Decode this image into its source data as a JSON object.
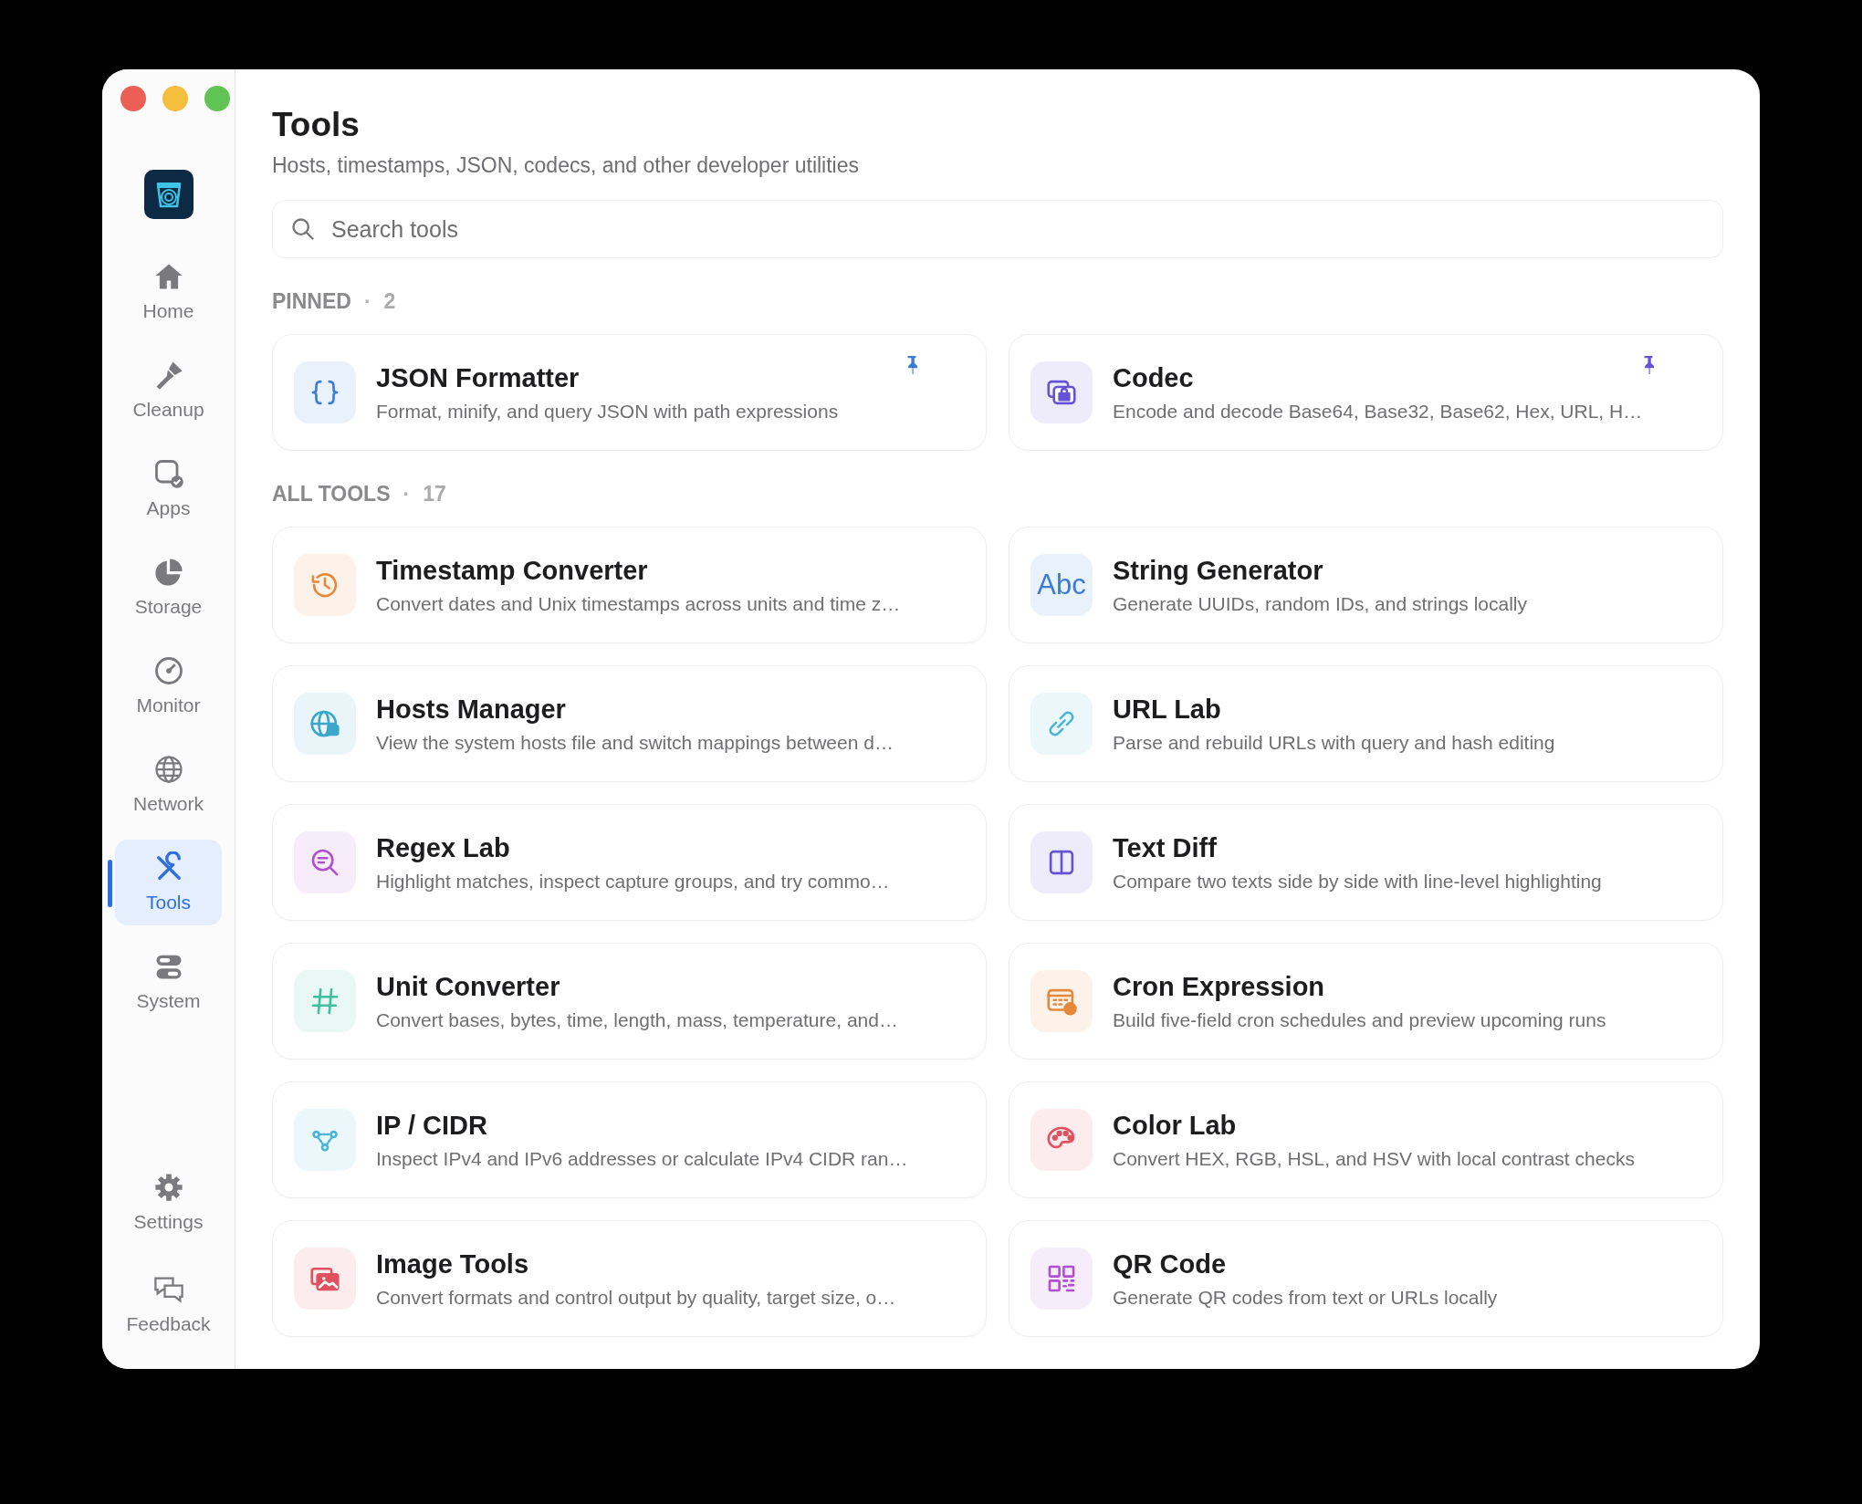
{
  "sidebar": {
    "items": [
      {
        "label": "Home",
        "kind": "home",
        "selected": false
      },
      {
        "label": "Cleanup",
        "kind": "brush",
        "selected": false
      },
      {
        "label": "Apps",
        "kind": "apps",
        "selected": false
      },
      {
        "label": "Storage",
        "kind": "pie",
        "selected": false
      },
      {
        "label": "Monitor",
        "kind": "gauge",
        "selected": false
      },
      {
        "label": "Network",
        "kind": "globe",
        "selected": false
      },
      {
        "label": "Tools",
        "kind": "tools",
        "selected": true
      },
      {
        "label": "System",
        "kind": "toggles",
        "selected": false
      }
    ],
    "bottom_items": [
      {
        "label": "Settings",
        "kind": "gear",
        "selected": false
      },
      {
        "label": "Feedback",
        "kind": "chat",
        "selected": false
      }
    ]
  },
  "header": {
    "title": "Tools",
    "subtitle": "Hosts, timestamps, JSON, codecs, and other developer utilities"
  },
  "search": {
    "placeholder": "Search tools"
  },
  "pinned": {
    "heading": "PINNED",
    "separator": "·",
    "count": "2",
    "tools": [
      {
        "name": "JSON Formatter",
        "description": "Format, minify, and query JSON with path expressions",
        "kind": "braces",
        "color": "#3a7bd5",
        "pinned": true
      },
      {
        "name": "Codec",
        "description": "Encode and decode Base64, Base32, Base62, Hex, URL, H…",
        "kind": "lock",
        "color": "#6652d6",
        "pinned": true
      }
    ]
  },
  "all_tools": {
    "heading": "ALL TOOLS",
    "separator": "·",
    "count": "17",
    "tools": [
      {
        "name": "Timestamp Converter",
        "description": "Convert dates and Unix timestamps across units and time z…",
        "kind": "history",
        "color": "#e5883a",
        "pinned": false
      },
      {
        "name": "String Generator",
        "description": "Generate UUIDs, random IDs, and strings locally",
        "kind": "text",
        "icon_text": "Abc",
        "color": "#3a7bd5",
        "pinned": false
      },
      {
        "name": "Hosts Manager",
        "description": "View the system hosts file and switch mappings between d…",
        "kind": "globe",
        "color": "#3aa6c9",
        "pinned": false
      },
      {
        "name": "URL Lab",
        "description": "Parse and rebuild URLs with query and hash editing",
        "kind": "link",
        "color": "#4bb5d6",
        "pinned": false
      },
      {
        "name": "Regex Lab",
        "description": "Highlight matches, inspect capture groups, and try commo…",
        "kind": "search",
        "color": "#b04fd0",
        "pinned": false
      },
      {
        "name": "Text Diff",
        "description": "Compare two texts side by side with line-level highlighting",
        "kind": "split",
        "color": "#6652d6",
        "pinned": false
      },
      {
        "name": "Unit Converter",
        "description": "Convert bases, bytes, time, length, mass, temperature, and…",
        "kind": "hash",
        "color": "#3cc0a0",
        "pinned": false
      },
      {
        "name": "Cron Expression",
        "description": "Build five-field cron schedules and preview upcoming runs",
        "kind": "calendar",
        "color": "#e5883a",
        "pinned": false
      },
      {
        "name": "IP / CIDR",
        "description": "Inspect IPv4 and IPv6 addresses or calculate IPv4 CIDR ran…",
        "kind": "nodes",
        "color": "#4bb5d6",
        "pinned": false
      },
      {
        "name": "Color Lab",
        "description": "Convert HEX, RGB, HSL, and HSV with local contrast checks",
        "kind": "palette",
        "color": "#e0505e",
        "pinned": false
      },
      {
        "name": "Image Tools",
        "description": "Convert formats and control output by quality, target size, o…",
        "kind": "images",
        "color": "#e0505e",
        "pinned": false
      },
      {
        "name": "QR Code",
        "description": "Generate QR codes from text or URLs locally",
        "kind": "qr",
        "color": "#b04fd0",
        "pinned": false
      }
    ]
  }
}
